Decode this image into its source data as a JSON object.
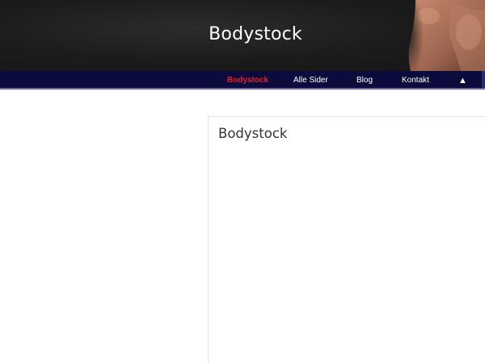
{
  "header": {
    "site_title": "Bodystock"
  },
  "nav": {
    "items": [
      {
        "label": "Bodystock",
        "active": true
      },
      {
        "label": "Alle Sider",
        "active": false
      },
      {
        "label": "Blog",
        "active": false
      },
      {
        "label": "Kontakt",
        "active": false
      }
    ],
    "scroll_top_icon": "▲"
  },
  "main": {
    "page_title": "Bodystock"
  },
  "colors": {
    "nav_background": "#0c0c3c",
    "active_link": "#e0222a",
    "header_background": "#1b1b1b"
  }
}
